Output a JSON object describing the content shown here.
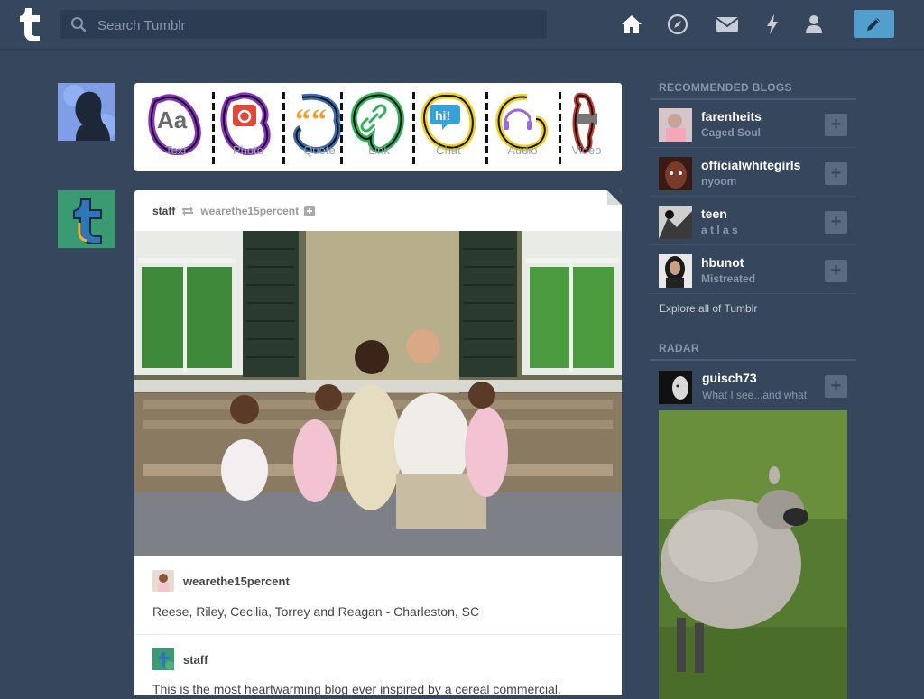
{
  "header": {
    "logo_letter": "t",
    "search": {
      "placeholder": "Search Tumblr",
      "value": ""
    },
    "nav": [
      "home-icon",
      "explore-compass-icon",
      "mail-icon",
      "activity-lightning-icon",
      "account-icon"
    ],
    "compose_icon": "pencil-icon"
  },
  "post_types": [
    {
      "label": "Text",
      "icon": "Aa",
      "color": "#8b2fc9"
    },
    {
      "label": "Photo",
      "icon": "camera",
      "color": "#e0483a"
    },
    {
      "label": "Quote",
      "icon": "quote",
      "color": "#f0a030"
    },
    {
      "label": "Link",
      "icon": "link",
      "color": "#2fb05a"
    },
    {
      "label": "Chat",
      "icon": "hi!",
      "color": "#3aa0d8"
    },
    {
      "label": "Audio",
      "icon": "headphones",
      "color": "#9a6ad8"
    },
    {
      "label": "Video",
      "icon": "video",
      "color": "#c0392b"
    }
  ],
  "post": {
    "author": "staff",
    "reblogged_from": "wearethe15percent",
    "caption_user": "wearethe15percent",
    "caption": "Reese, Riley, Cecilia, Torrey and Reagan - Charleston, SC",
    "reblog_user": "staff",
    "body": "This is the most heartwarming blog ever inspired by a cereal commercial."
  },
  "sidebar": {
    "recommended_heading": "RECOMMENDED BLOGS",
    "blogs": [
      {
        "name": "farenheits",
        "subtitle": "Caged Soul"
      },
      {
        "name": "officialwhitegirls",
        "subtitle": "nyoom"
      },
      {
        "name": "teen",
        "subtitle": "a t l a s"
      },
      {
        "name": "hbunot",
        "subtitle": "Mistreated"
      }
    ],
    "explore_link": "Explore all of Tumblr",
    "radar_heading": "RADAR",
    "radar": {
      "name": "guisch73",
      "subtitle": "What I see...and what"
    },
    "follow_label": "+"
  },
  "colors": {
    "background": "#36465d",
    "accent": "#529ecc",
    "card": "#ffffff"
  }
}
